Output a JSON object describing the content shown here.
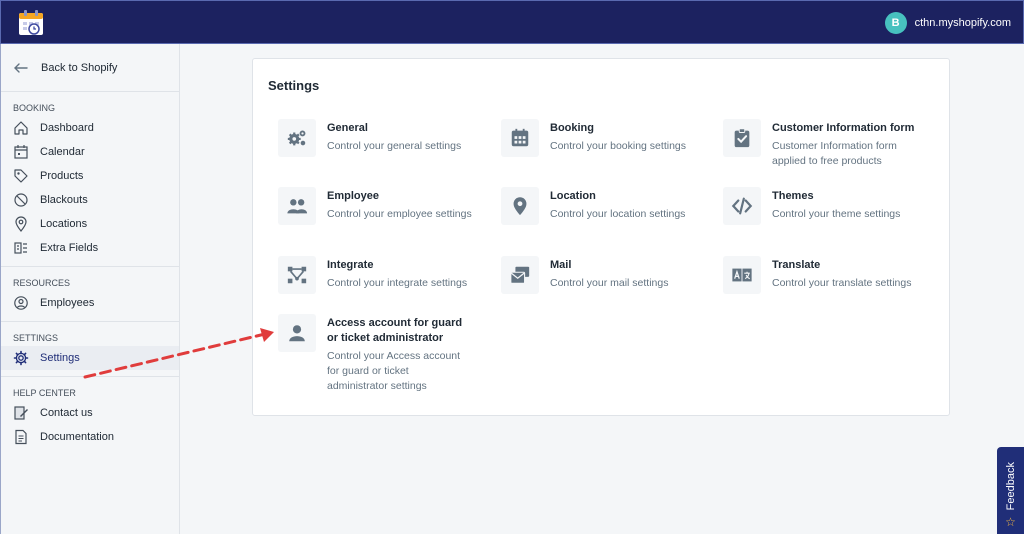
{
  "topbar": {
    "avatar_letter": "B",
    "store_name": "cthn.myshopify.com"
  },
  "sidebar": {
    "back_label": "Back to Shopify",
    "sections": [
      {
        "title": "BOOKING",
        "items": [
          "Dashboard",
          "Calendar",
          "Products",
          "Blackouts",
          "Locations",
          "Extra Fields"
        ]
      },
      {
        "title": "RESOURCES",
        "items": [
          "Employees"
        ]
      },
      {
        "title": "SETTINGS",
        "items": [
          "Settings"
        ]
      },
      {
        "title": "HELP CENTER",
        "items": [
          "Contact us",
          "Documentation"
        ]
      }
    ]
  },
  "panel": {
    "title": "Settings",
    "cards": [
      {
        "title": "General",
        "desc": "Control your general settings",
        "icon": "gears-icon"
      },
      {
        "title": "Booking",
        "desc": "Control your booking settings",
        "icon": "calendar-icon"
      },
      {
        "title": "Customer Information form",
        "desc": "Customer Information form applied to free products",
        "icon": "clipboard-check-icon"
      },
      {
        "title": "Employee",
        "desc": "Control your employee settings",
        "icon": "users-icon"
      },
      {
        "title": "Location",
        "desc": "Control your location settings",
        "icon": "map-pin-icon"
      },
      {
        "title": "Themes",
        "desc": "Control your theme settings",
        "icon": "code-icon"
      },
      {
        "title": "Integrate",
        "desc": "Control your integrate settings",
        "icon": "integrate-icon"
      },
      {
        "title": "Mail",
        "desc": "Control your mail settings",
        "icon": "mail-icon"
      },
      {
        "title": "Translate",
        "desc": "Control your translate settings",
        "icon": "translate-icon"
      },
      {
        "title": "Access account for guard or ticket administrator",
        "desc": "Control your Access account for guard or ticket administrator settings",
        "icon": "user-icon"
      }
    ]
  },
  "feedback": {
    "label": "Feedback"
  },
  "colors": {
    "topbar": "#1c2260",
    "accent": "#202e78",
    "annotation_arrow": "#e03c3c",
    "avatar": "#47c1bf"
  }
}
